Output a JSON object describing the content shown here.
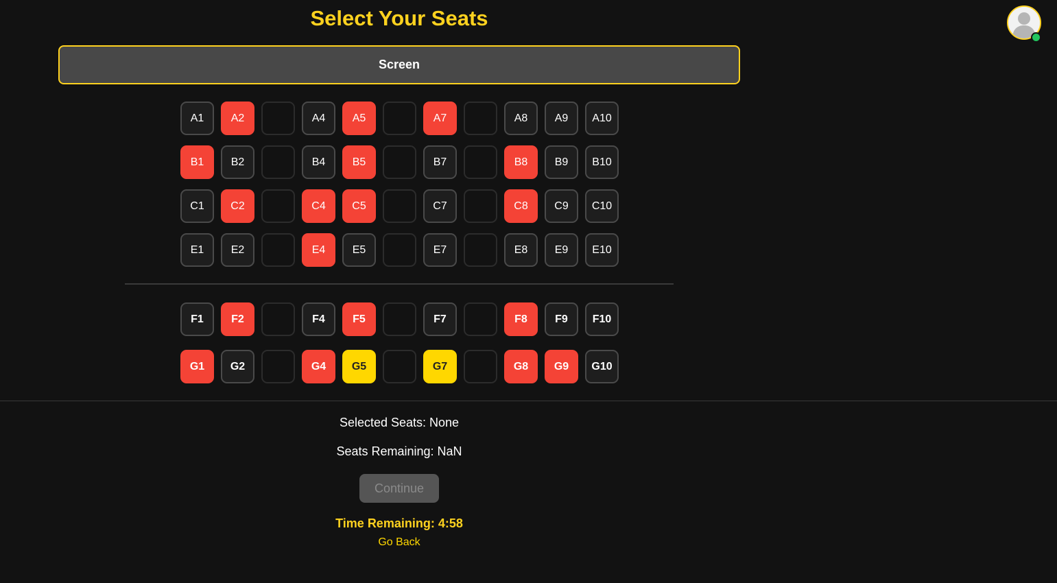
{
  "page": {
    "title": "Select Your Seats",
    "screen_label": "Screen"
  },
  "user": {
    "avatar_icon": "user-avatar-icon",
    "status": "online",
    "status_color": "#22c55e"
  },
  "colors": {
    "accent": "#ffd21f",
    "taken": "#f44336",
    "selected": "#ffd700",
    "available": "#1e1e1e"
  },
  "rows": [
    {
      "name": "A",
      "seats": [
        {
          "label": "A1",
          "state": "available"
        },
        {
          "label": "A2",
          "state": "taken"
        },
        {
          "label": "",
          "state": "gap"
        },
        {
          "label": "A4",
          "state": "available"
        },
        {
          "label": "A5",
          "state": "taken"
        },
        {
          "label": "",
          "state": "gap"
        },
        {
          "label": "A7",
          "state": "taken"
        },
        {
          "label": "",
          "state": "gap"
        },
        {
          "label": "A8",
          "state": "available"
        },
        {
          "label": "A9",
          "state": "available"
        },
        {
          "label": "A10",
          "state": "available"
        }
      ]
    },
    {
      "name": "B",
      "seats": [
        {
          "label": "B1",
          "state": "taken"
        },
        {
          "label": "B2",
          "state": "available"
        },
        {
          "label": "",
          "state": "gap"
        },
        {
          "label": "B4",
          "state": "available"
        },
        {
          "label": "B5",
          "state": "taken"
        },
        {
          "label": "",
          "state": "gap"
        },
        {
          "label": "B7",
          "state": "available"
        },
        {
          "label": "",
          "state": "gap"
        },
        {
          "label": "B8",
          "state": "taken"
        },
        {
          "label": "B9",
          "state": "available"
        },
        {
          "label": "B10",
          "state": "available"
        }
      ]
    },
    {
      "name": "C",
      "seats": [
        {
          "label": "C1",
          "state": "available"
        },
        {
          "label": "C2",
          "state": "taken"
        },
        {
          "label": "",
          "state": "gap"
        },
        {
          "label": "C4",
          "state": "taken"
        },
        {
          "label": "C5",
          "state": "taken"
        },
        {
          "label": "",
          "state": "gap"
        },
        {
          "label": "C7",
          "state": "available"
        },
        {
          "label": "",
          "state": "gap"
        },
        {
          "label": "C8",
          "state": "taken"
        },
        {
          "label": "C9",
          "state": "available"
        },
        {
          "label": "C10",
          "state": "available"
        }
      ]
    },
    {
      "name": "E",
      "seats": [
        {
          "label": "E1",
          "state": "available"
        },
        {
          "label": "E2",
          "state": "available"
        },
        {
          "label": "",
          "state": "gap"
        },
        {
          "label": "E4",
          "state": "taken"
        },
        {
          "label": "E5",
          "state": "available"
        },
        {
          "label": "",
          "state": "gap"
        },
        {
          "label": "E7",
          "state": "available"
        },
        {
          "label": "",
          "state": "gap"
        },
        {
          "label": "E8",
          "state": "available"
        },
        {
          "label": "E9",
          "state": "available"
        },
        {
          "label": "E10",
          "state": "available"
        }
      ]
    },
    {
      "name": "F",
      "bold": true,
      "seats": [
        {
          "label": "F1",
          "state": "available"
        },
        {
          "label": "F2",
          "state": "taken"
        },
        {
          "label": "",
          "state": "gap"
        },
        {
          "label": "F4",
          "state": "available"
        },
        {
          "label": "F5",
          "state": "taken"
        },
        {
          "label": "",
          "state": "gap"
        },
        {
          "label": "F7",
          "state": "available"
        },
        {
          "label": "",
          "state": "gap"
        },
        {
          "label": "F8",
          "state": "taken"
        },
        {
          "label": "F9",
          "state": "available"
        },
        {
          "label": "F10",
          "state": "available"
        }
      ]
    },
    {
      "name": "G",
      "bold": true,
      "seats": [
        {
          "label": "G1",
          "state": "taken"
        },
        {
          "label": "G2",
          "state": "available"
        },
        {
          "label": "",
          "state": "gap"
        },
        {
          "label": "G4",
          "state": "taken"
        },
        {
          "label": "G5",
          "state": "selected"
        },
        {
          "label": "",
          "state": "gap"
        },
        {
          "label": "G7",
          "state": "selected"
        },
        {
          "label": "",
          "state": "gap"
        },
        {
          "label": "G8",
          "state": "taken"
        },
        {
          "label": "G9",
          "state": "taken"
        },
        {
          "label": "G10",
          "state": "available"
        }
      ]
    }
  ],
  "summary": {
    "selected_seats": "Selected Seats: None",
    "seats_remaining": "Seats Remaining: NaN",
    "continue_label": "Continue",
    "continue_disabled": true,
    "time_remaining": "Time Remaining: 4:58",
    "go_back_label": "Go Back"
  }
}
